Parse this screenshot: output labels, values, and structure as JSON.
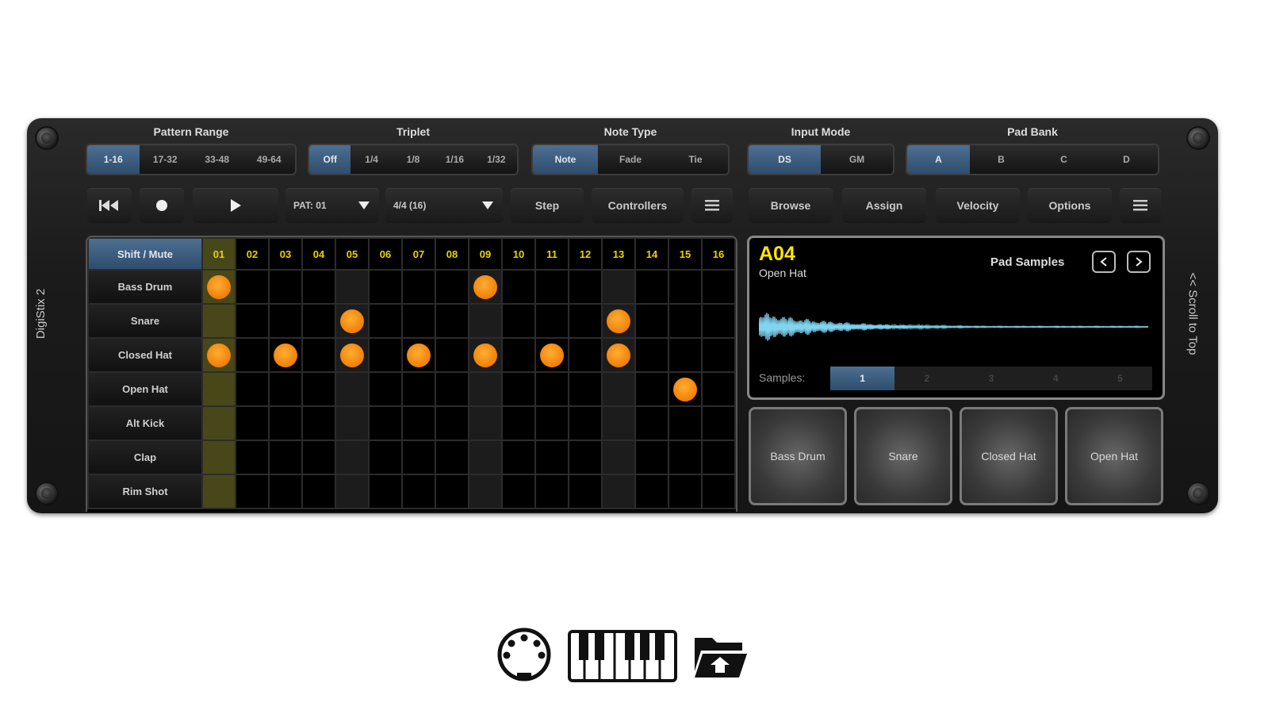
{
  "app": {
    "side_title": "DigiStix 2",
    "scroll_label": "<< Scroll to Top"
  },
  "groups": {
    "pattern_range": {
      "title": "Pattern Range",
      "options": [
        "1-16",
        "17-32",
        "33-48",
        "49-64"
      ],
      "selected": 0
    },
    "triplet": {
      "title": "Triplet",
      "options": [
        "Off",
        "1/4",
        "1/8",
        "1/16",
        "1/32"
      ],
      "selected": 0
    },
    "note_type": {
      "title": "Note Type",
      "options": [
        "Note",
        "Fade",
        "Tie"
      ],
      "selected": 0
    },
    "input_mode": {
      "title": "Input Mode",
      "options": [
        "DS",
        "GM"
      ],
      "selected": 0
    },
    "pad_bank": {
      "title": "Pad Bank",
      "options": [
        "A",
        "B",
        "C",
        "D"
      ],
      "selected": 0
    }
  },
  "toolbar": {
    "pattern_select": "PAT: 01",
    "signature_select": "4/4 (16)",
    "step": "Step",
    "controllers": "Controllers",
    "browse": "Browse",
    "assign": "Assign",
    "velocity": "Velocity",
    "options": "Options"
  },
  "sequencer": {
    "corner_label": "Shift / Mute",
    "steps": [
      "01",
      "02",
      "03",
      "04",
      "05",
      "06",
      "07",
      "08",
      "09",
      "10",
      "11",
      "12",
      "13",
      "14",
      "15",
      "16"
    ],
    "current_step": 1,
    "rows": [
      {
        "name": "Bass Drum",
        "hits": [
          1,
          9
        ]
      },
      {
        "name": "Snare",
        "hits": [
          5,
          13
        ]
      },
      {
        "name": "Closed Hat",
        "hits": [
          1,
          3,
          5,
          7,
          9,
          11,
          13
        ]
      },
      {
        "name": "Open Hat",
        "hits": [
          15
        ]
      },
      {
        "name": "Alt Kick",
        "hits": []
      },
      {
        "name": "Clap",
        "hits": []
      },
      {
        "name": "Rim Shot",
        "hits": []
      }
    ]
  },
  "sample_panel": {
    "pad_id": "A04",
    "pad_name": "Open Hat",
    "title": "Pad Samples",
    "samples_label": "Samples:",
    "samples": [
      "1",
      "2",
      "3",
      "4",
      "5"
    ],
    "selected_sample": 0,
    "waveform_color": "#7fd4f0"
  },
  "pads": [
    "Bass Drum",
    "Snare",
    "Closed Hat",
    "Open Hat"
  ],
  "colors": {
    "accent": "#3d5f82",
    "step_current": "#47471a",
    "hit": "#f39a1c",
    "step_label": "#e3d500",
    "pad_id": "#ffe600"
  }
}
